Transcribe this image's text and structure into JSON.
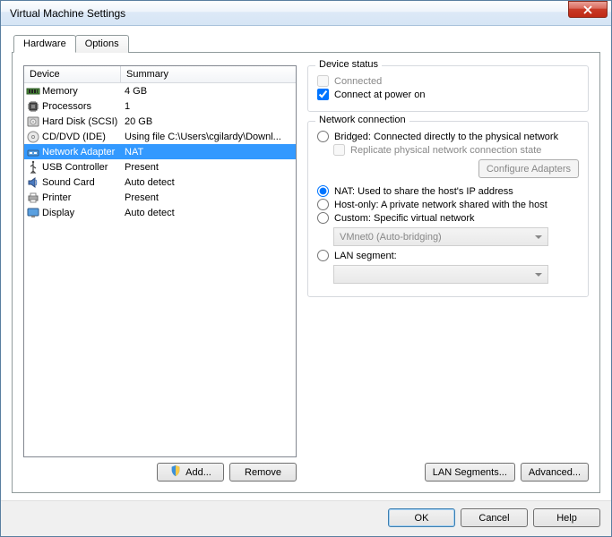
{
  "window": {
    "title": "Virtual Machine Settings"
  },
  "tabs": {
    "hardware": "Hardware",
    "options": "Options"
  },
  "columns": {
    "device": "Device",
    "summary": "Summary"
  },
  "devices": [
    {
      "name": "Memory",
      "summary": "4 GB"
    },
    {
      "name": "Processors",
      "summary": "1"
    },
    {
      "name": "Hard Disk (SCSI)",
      "summary": "20 GB"
    },
    {
      "name": "CD/DVD (IDE)",
      "summary": "Using file C:\\Users\\cgilardy\\Downl..."
    },
    {
      "name": "Network Adapter",
      "summary": "NAT"
    },
    {
      "name": "USB Controller",
      "summary": "Present"
    },
    {
      "name": "Sound Card",
      "summary": "Auto detect"
    },
    {
      "name": "Printer",
      "summary": "Present"
    },
    {
      "name": "Display",
      "summary": "Auto detect"
    }
  ],
  "buttons": {
    "add": "Add...",
    "remove": "Remove",
    "configure_adapters": "Configure Adapters",
    "lan_segments": "LAN Segments...",
    "advanced": "Advanced...",
    "ok": "OK",
    "cancel": "Cancel",
    "help": "Help"
  },
  "device_status": {
    "title": "Device status",
    "connected": "Connected",
    "connect_at_power_on": "Connect at power on"
  },
  "network_connection": {
    "title": "Network connection",
    "bridged": "Bridged: Connected directly to the physical network",
    "replicate": "Replicate physical network connection state",
    "nat": "NAT: Used to share the host's IP address",
    "host_only": "Host-only: A private network shared with the host",
    "custom": "Custom: Specific virtual network",
    "custom_value": "VMnet0 (Auto-bridging)",
    "lan_segment": "LAN segment:"
  }
}
